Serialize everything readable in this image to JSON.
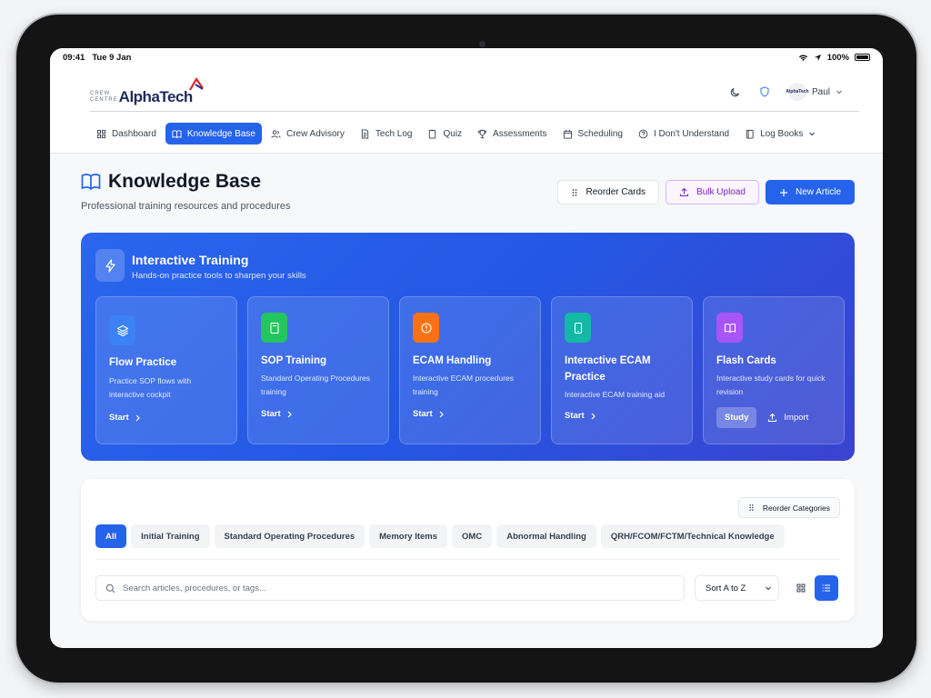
{
  "status": {
    "time": "09:41",
    "date": "Tue 9 Jan",
    "battery": "100%"
  },
  "brand": {
    "crew": "CREW",
    "centre": "CENTRE",
    "name": "AlphaTech"
  },
  "user": {
    "avatar_text": "AlphaTech",
    "name": "Paul"
  },
  "nav": [
    {
      "label": "Dashboard",
      "icon": "grid-icon",
      "active": false
    },
    {
      "label": "Knowledge Base",
      "icon": "book-icon",
      "active": true
    },
    {
      "label": "Crew Advisory",
      "icon": "users-icon",
      "active": false
    },
    {
      "label": "Tech Log",
      "icon": "file-icon",
      "active": false
    },
    {
      "label": "Quiz",
      "icon": "clipboard-icon",
      "active": false
    },
    {
      "label": "Assessments",
      "icon": "trophy-icon",
      "active": false
    },
    {
      "label": "Scheduling",
      "icon": "calendar-icon",
      "active": false
    },
    {
      "label": "I Don't Understand",
      "icon": "help-icon",
      "active": false
    },
    {
      "label": "Log Books",
      "icon": "notebook-icon",
      "active": false
    }
  ],
  "page": {
    "title": "Knowledge Base",
    "subtitle": "Professional training resources and procedures"
  },
  "actions": {
    "reorder": "Reorder Cards",
    "bulk_upload": "Bulk Upload",
    "new_article": "New Article"
  },
  "training": {
    "title": "Interactive Training",
    "subtitle": "Hands-on practice tools to sharpen your skills",
    "cards": [
      {
        "title": "Flow Practice",
        "desc": "Practice SOP flows with interactive cockpit",
        "action": "Start",
        "color": "#3b82f6"
      },
      {
        "title": "SOP Training",
        "desc": "Standard Operating Procedures training",
        "action": "Start",
        "color": "#22c55e"
      },
      {
        "title": "ECAM Handling",
        "desc": "Interactive ECAM procedures training",
        "action": "Start",
        "color": "#f97316"
      },
      {
        "title": "Interactive ECAM Practice",
        "desc": "Interactive ECAM training aid",
        "action": "Start",
        "color": "#14b8a6"
      },
      {
        "title": "Flash Cards",
        "desc": "Interactive study cards for quick revision",
        "action": "Study",
        "action2": "Import",
        "color": "#a855f7"
      }
    ]
  },
  "filters": {
    "reorder_categories": "Reorder Categories",
    "chips": [
      "All",
      "Initial Training",
      "Standard Operating Procedures",
      "Memory Items",
      "OMC",
      "Abnormal Handling",
      "QRH/FCOM/FCTM/Technical Knowledge"
    ],
    "active_chip": 0,
    "search_placeholder": "Search articles, procedures, or tags...",
    "sort": "Sort A to Z"
  }
}
